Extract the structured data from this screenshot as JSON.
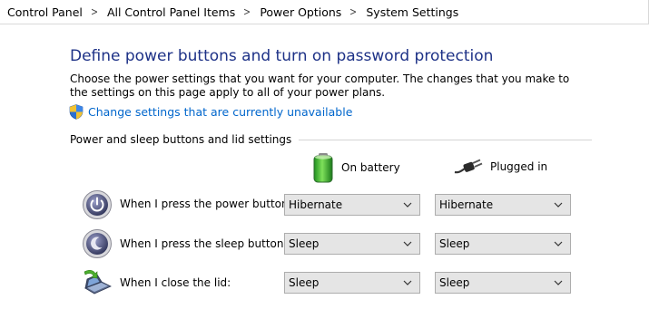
{
  "breadcrumb": {
    "items": [
      "Control Panel",
      "All Control Panel Items",
      "Power Options",
      "System Settings"
    ]
  },
  "page": {
    "title": "Define power buttons and turn on password protection",
    "description": "Choose the power settings that you want for your computer. The changes that you make to the settings on this page apply to all of your power plans.",
    "uac_link": "Change settings that are currently unavailable"
  },
  "group": {
    "header": "Power and sleep buttons and lid settings",
    "columns": {
      "battery": "On battery",
      "plugged": "Plugged in"
    },
    "rows": [
      {
        "label": "When I press the power button:",
        "icon": "power-button-icon",
        "battery": "Hibernate",
        "plugged": "Hibernate"
      },
      {
        "label": "When I press the sleep button:",
        "icon": "sleep-button-icon",
        "battery": "Sleep",
        "plugged": "Sleep"
      },
      {
        "label": "When I close the lid:",
        "icon": "laptop-lid-icon",
        "battery": "Sleep",
        "plugged": "Sleep"
      }
    ]
  },
  "colors": {
    "title": "#1e3287",
    "link": "#0066cc",
    "dropdown_bg": "#e5e5e5"
  }
}
